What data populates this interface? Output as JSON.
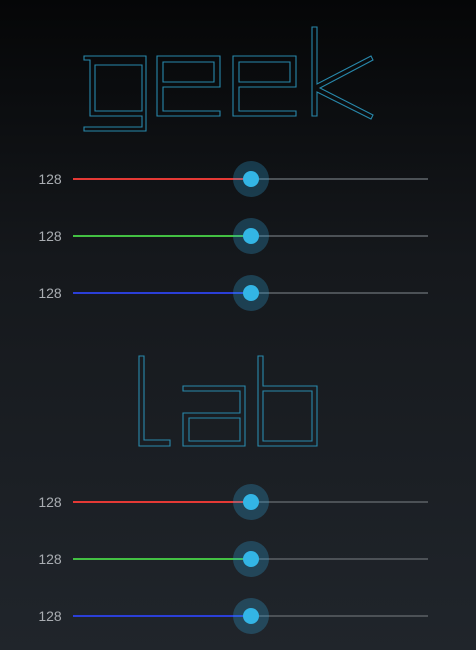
{
  "logos": {
    "top": "geek",
    "bottom": "Lab"
  },
  "colors": {
    "accent": "#33b5e5",
    "logo_outline": "#2a8fb4",
    "track": "#4c5156",
    "red": "#e53935",
    "green": "#43c043",
    "blue": "#2b3fd8"
  },
  "sliders": [
    {
      "value": "128",
      "level": 0.5,
      "channel": "red"
    },
    {
      "value": "128",
      "level": 0.5,
      "channel": "green"
    },
    {
      "value": "128",
      "level": 0.5,
      "channel": "blue"
    },
    {
      "value": "128",
      "level": 0.5,
      "channel": "red"
    },
    {
      "value": "128",
      "level": 0.5,
      "channel": "green"
    },
    {
      "value": "128",
      "level": 0.5,
      "channel": "blue"
    }
  ]
}
